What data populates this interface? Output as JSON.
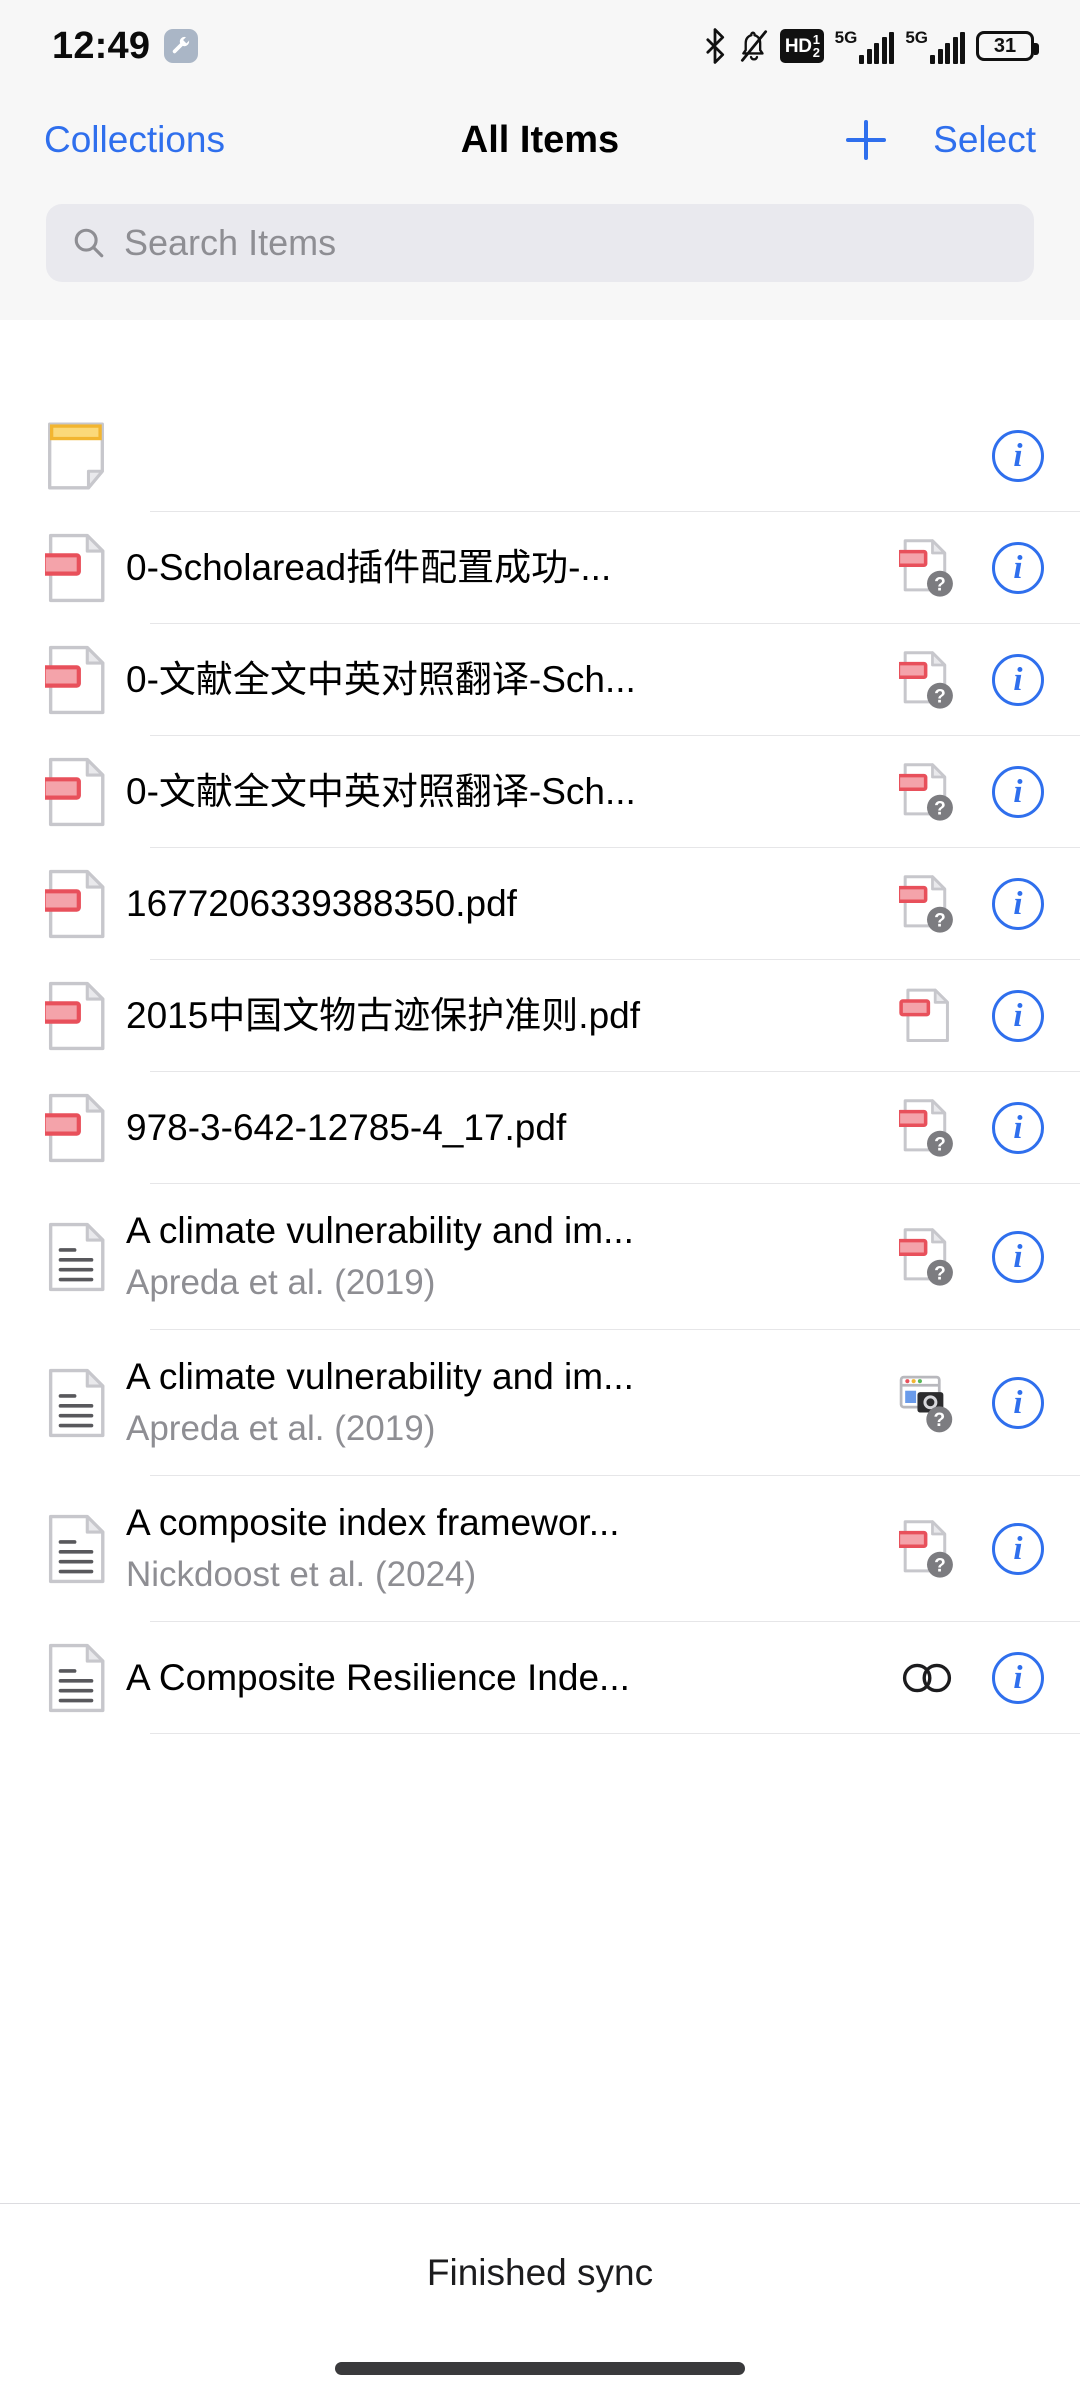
{
  "status_bar": {
    "time": "12:49",
    "wrench_icon": "wrench-icon",
    "bluetooth_icon": "bluetooth-icon",
    "mute_icon": "bell-muted-icon",
    "hd_label": "HD",
    "hd_sup": "1",
    "hd_sub": "2",
    "signal_1_label": "5G",
    "signal_2_label": "5G",
    "battery_level": "31"
  },
  "nav": {
    "back_label": "Collections",
    "title": "All Items",
    "add_label": "add-item",
    "select_label": "Select"
  },
  "search": {
    "placeholder": "Search Items",
    "value": "",
    "icon": "search-icon"
  },
  "items": [
    {
      "title": "",
      "subtitle": "",
      "icon": "note-icon",
      "accessory": "",
      "info": "i"
    },
    {
      "title": "0-Scholaread插件配置成功-...",
      "subtitle": "",
      "icon": "pdf-attachment-icon",
      "accessory": "pdf-missing-icon",
      "info": "i"
    },
    {
      "title": "0-文献全文中英对照翻译-Sch...",
      "subtitle": "",
      "icon": "pdf-attachment-icon",
      "accessory": "pdf-missing-icon",
      "info": "i"
    },
    {
      "title": "0-文献全文中英对照翻译-Sch...",
      "subtitle": "",
      "icon": "pdf-attachment-icon",
      "accessory": "pdf-missing-icon",
      "info": "i"
    },
    {
      "title": "1677206339388350.pdf",
      "subtitle": "",
      "icon": "pdf-attachment-icon",
      "accessory": "pdf-missing-icon",
      "info": "i"
    },
    {
      "title": "2015中国文物古迹保护准则.pdf",
      "subtitle": "",
      "icon": "pdf-attachment-icon",
      "accessory": "pdf-downloaded-icon",
      "info": "i"
    },
    {
      "title": "978-3-642-12785-4_17.pdf",
      "subtitle": "",
      "icon": "pdf-attachment-icon",
      "accessory": "pdf-missing-icon",
      "info": "i"
    },
    {
      "title": "A climate vulnerability and im...",
      "subtitle": "Apreda et al. (2019)",
      "icon": "journal-article-icon",
      "accessory": "pdf-missing-icon",
      "info": "i"
    },
    {
      "title": "A climate vulnerability and im...",
      "subtitle": "Apreda et al. (2019)",
      "icon": "journal-article-icon",
      "accessory": "snapshot-missing-icon",
      "info": "i"
    },
    {
      "title": "A composite index framewor...",
      "subtitle": "Nickdoost et al. (2024)",
      "icon": "journal-article-icon",
      "accessory": "pdf-missing-icon",
      "info": "i"
    },
    {
      "title": "A Composite Resilience Inde...",
      "subtitle": "",
      "icon": "journal-article-icon",
      "accessory": "link-icon",
      "info": "i"
    }
  ],
  "toolbar": {
    "status_text": "Finished sync"
  },
  "colors": {
    "accent": "#2f6fed",
    "pdf_red": "#e8505b",
    "note_yellow": "#f2b530",
    "secondary_text": "#8e8e93",
    "header_bg": "#f7f7f7"
  }
}
